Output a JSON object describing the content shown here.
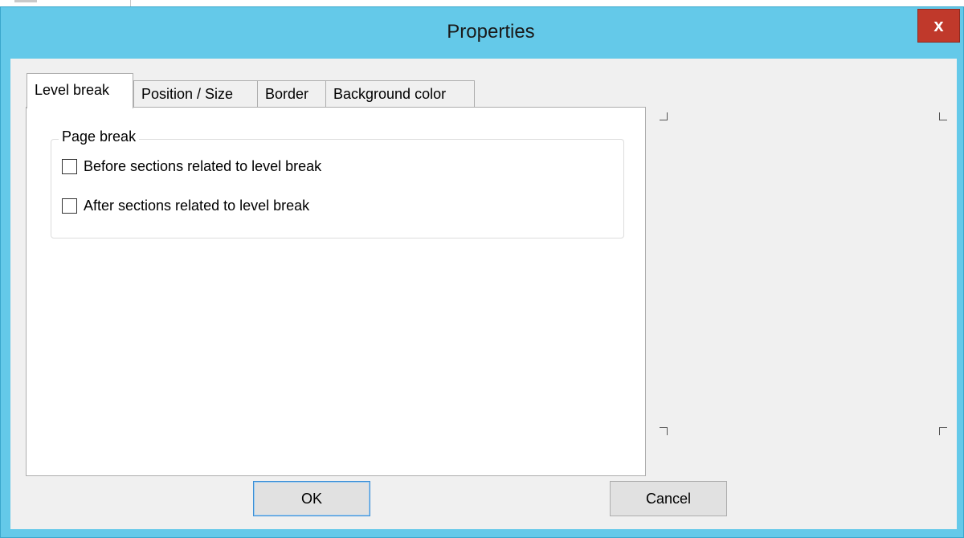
{
  "window": {
    "title": "Properties",
    "close_label": "x",
    "accent_color": "#64c9e9",
    "close_color": "#c0392b"
  },
  "tabs": [
    {
      "label": "Level break",
      "active": true
    },
    {
      "label": "Position / Size",
      "active": false
    },
    {
      "label": "Border",
      "active": false
    },
    {
      "label": "Background color",
      "active": false
    }
  ],
  "page_break": {
    "title": "Page break",
    "options": [
      {
        "label": "Before sections related to level break",
        "checked": false
      },
      {
        "label": "After sections related to level break",
        "checked": false
      }
    ]
  },
  "buttons": {
    "ok_label": "OK",
    "cancel_label": "Cancel"
  }
}
